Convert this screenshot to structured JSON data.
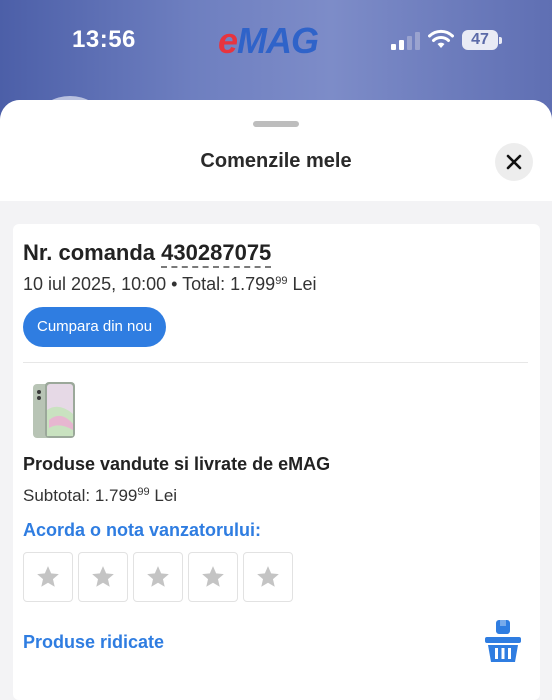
{
  "status_bar": {
    "time": "13:56",
    "battery": "47",
    "icons": [
      "signal-icon",
      "wifi-icon",
      "battery-icon"
    ]
  },
  "app": {
    "logo_e": "e",
    "logo_mag": "MAG"
  },
  "sheet": {
    "title": "Comenzile mele",
    "close_icon": "close-icon"
  },
  "order": {
    "label": "Nr. comanda",
    "number": "430287075",
    "date": "10 iul 2025, 10:00",
    "total_label": "Total: 1.799",
    "total_decimals": "99",
    "currency": "Lei",
    "rebuy_label": "Cumpara din nou"
  },
  "seller": {
    "title": "Produse vandute si livrate de eMAG",
    "subtotal_label": "Subtotal: 1.799",
    "subtotal_decimals": "99",
    "currency": "Lei",
    "rate_label": "Acorda o nota vanzatorului:",
    "stars": [
      "star-icon",
      "star-icon",
      "star-icon",
      "star-icon",
      "star-icon"
    ],
    "picked_label": "Produse ridicate",
    "picked_icon": "basket-icon"
  },
  "colors": {
    "accent": "#2f7de1",
    "logo_red": "#e7343f",
    "logo_blue": "#2f63c9"
  }
}
